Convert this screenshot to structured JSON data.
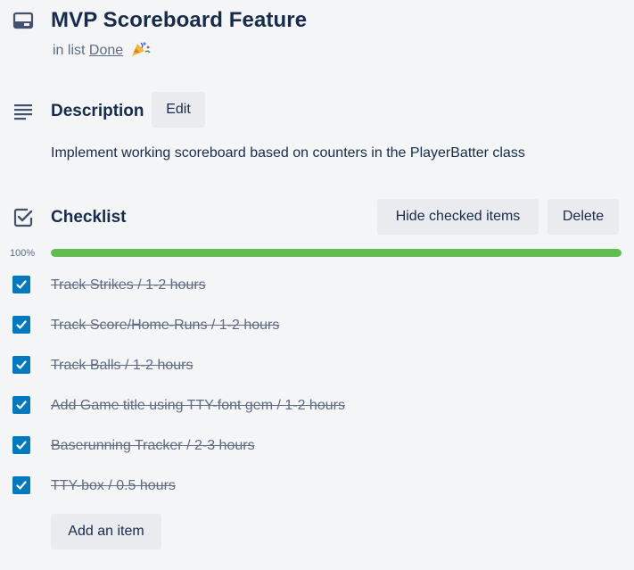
{
  "card": {
    "title": "MVP Scoreboard Feature",
    "list_prefix": "in list",
    "list_name": "Done"
  },
  "description": {
    "title": "Description",
    "edit_label": "Edit",
    "text": "Implement working scoreboard based on counters in the PlayerBatter class"
  },
  "checklist": {
    "title": "Checklist",
    "hide_checked_label": "Hide checked items",
    "delete_label": "Delete",
    "progress_label": "100%",
    "progress_percent": 100,
    "add_item_label": "Add an item",
    "items": [
      {
        "text": "Track Strikes / 1-2 hours",
        "checked": true
      },
      {
        "text": "Track Score/Home-Runs / 1-2 hours",
        "checked": true
      },
      {
        "text": "Track Balls / 1-2 hours",
        "checked": true
      },
      {
        "text": "Add Game title using TTY-font gem / 1-2 hours",
        "checked": true
      },
      {
        "text": "Baserunning Tracker / 2-3 hours",
        "checked": true
      },
      {
        "text": "TTY-box / 0.5 hours",
        "checked": true
      }
    ]
  },
  "colors": {
    "text_primary": "#172b4d",
    "text_muted": "#5e6c84",
    "background": "#f4f5f7",
    "button_bg": "#e9ebee",
    "checkbox_blue": "#0079bf",
    "progress_green": "#61bd4f",
    "progress_track": "#dfe1e6"
  },
  "icons": {
    "card": "card-icon",
    "description": "description-lines-icon",
    "checklist": "checklist-icon",
    "checkbox_check": "check-mark-icon",
    "list_emoji": "party-popper-icon"
  }
}
